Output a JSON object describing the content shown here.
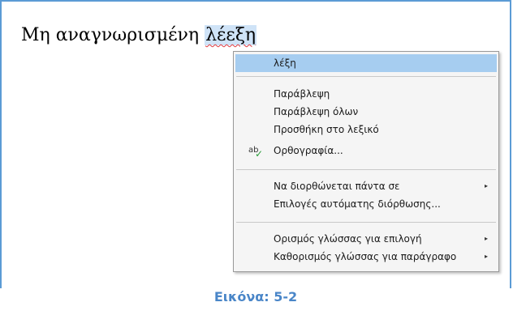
{
  "document": {
    "text_before": "Μη αναγνωρισμένη ",
    "misspelled_word": "λέεξη"
  },
  "context_menu": {
    "suggestion": "λέξη",
    "ignore": "Παράβλεψη",
    "ignore_all": "Παράβλεψη όλων",
    "add_to_dictionary": "Προσθήκη στο λεξικό",
    "spelling": "Ορθογραφία...",
    "always_correct_to": "Να διορθώνεται πάντα σε",
    "autocorrect_options": "Επιλογές αυτόματης διόρθωσης...",
    "set_language_selection": "Ορισμός γλώσσας για επιλογή",
    "set_language_paragraph": "Καθορισμός γλώσσας για παράγραφο",
    "submenu_arrow": "▸",
    "spell_icon_text": "ab",
    "spell_icon_check": "✓",
    "colors": {
      "highlight": "#a6cdf0",
      "check": "#2a9d3a"
    }
  },
  "caption": "Εικόνα: 5-2"
}
